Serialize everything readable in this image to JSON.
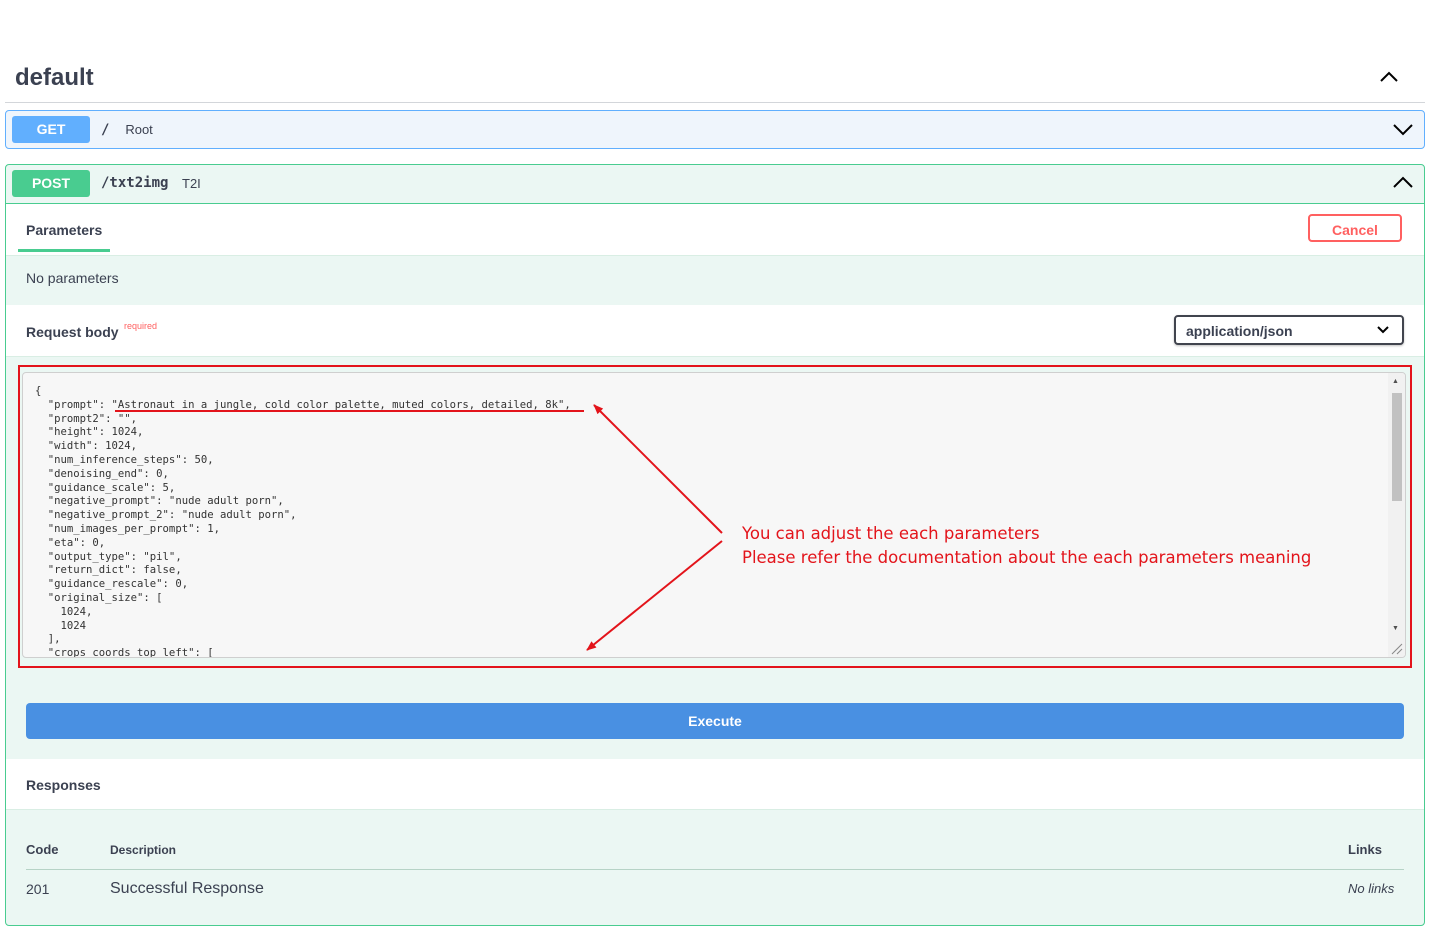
{
  "section": {
    "title": "default"
  },
  "get_op": {
    "method": "GET",
    "path": "/",
    "summary": "Root"
  },
  "post_op": {
    "method": "POST",
    "path": "/txt2img",
    "summary": "T2I",
    "tabs": {
      "parameters": "Parameters"
    },
    "cancel_label": "Cancel",
    "no_parameters": "No parameters",
    "request_body": {
      "label": "Request body",
      "required": "required",
      "content_type": "application/json"
    },
    "body_text": "{\n  \"prompt\": \"Astronaut in a jungle, cold color palette, muted colors, detailed, 8k\",\n  \"prompt2\": \"\",\n  \"height\": 1024,\n  \"width\": 1024,\n  \"num_inference_steps\": 50,\n  \"denoising_end\": 0,\n  \"guidance_scale\": 5,\n  \"negative_prompt\": \"nude adult porn\",\n  \"negative_prompt_2\": \"nude adult porn\",\n  \"num_images_per_prompt\": 1,\n  \"eta\": 0,\n  \"output_type\": \"pil\",\n  \"return_dict\": false,\n  \"guidance_rescale\": 0,\n  \"original_size\": [\n    1024,\n    1024\n  ],\n  \"crops_coords_top_left\": [",
    "execute_label": "Execute",
    "responses": {
      "label": "Responses",
      "headers": {
        "code": "Code",
        "description": "Description",
        "links": "Links"
      },
      "rows": [
        {
          "code": "201",
          "description": "Successful Response",
          "links": "No links"
        }
      ]
    }
  },
  "annotation": {
    "line1": "You can adjust the each parameters",
    "line2": "Please refer the documentation about the each parameters meaning"
  },
  "colors": {
    "get": "#61affe",
    "post": "#49cc90",
    "cancel": "#ff6060",
    "execute": "#4990e2",
    "annotation": "#e3141b"
  },
  "icons": [
    "chevron-up-icon",
    "chevron-down-icon",
    "resize-grip-icon"
  ]
}
